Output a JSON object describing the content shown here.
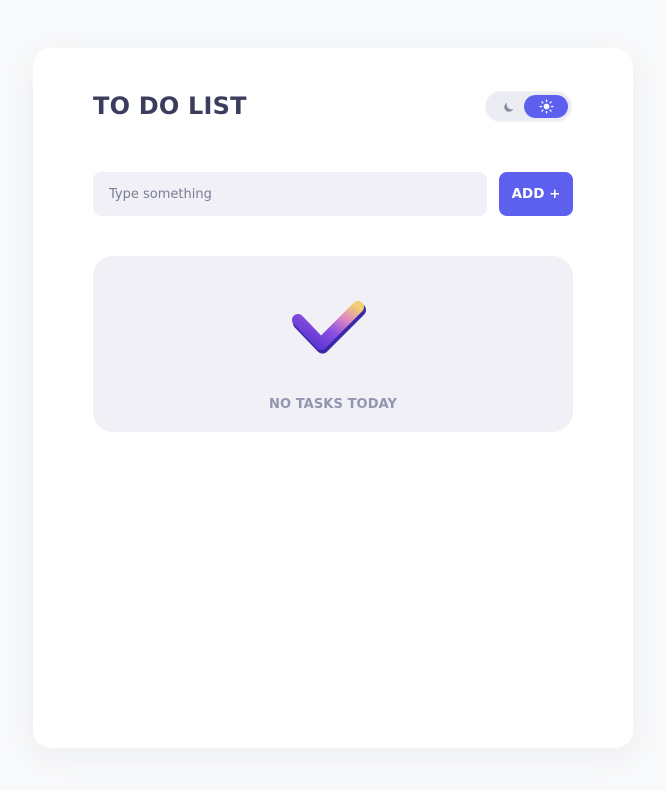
{
  "app": {
    "title": "TO DO LIST"
  },
  "theme_toggle": {
    "options": [
      "moon-icon",
      "sun-icon"
    ],
    "active": "light",
    "active_color": "#5d5fef"
  },
  "task_form": {
    "placeholder": "Type something",
    "value": "",
    "add_label": "ADD +"
  },
  "empty_state": {
    "icon": "checkmark-icon",
    "message": "NO TASKS TODAY"
  },
  "colors": {
    "accent": "#5d5fef",
    "title": "#3a3d5c",
    "panel": "#f0f0f6",
    "muted_text": "#9295b0"
  }
}
